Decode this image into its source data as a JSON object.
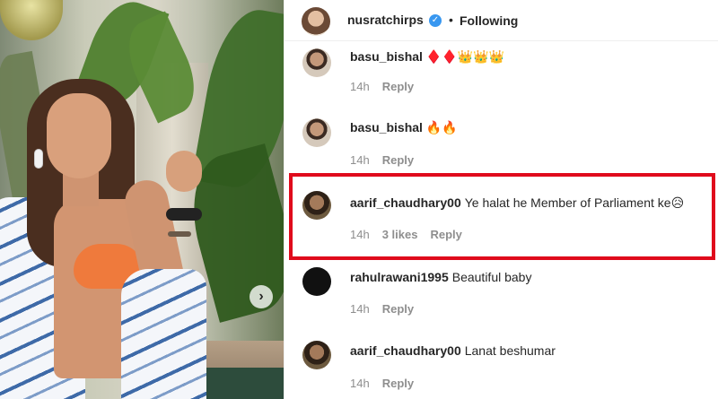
{
  "header": {
    "username": "nusratchirps",
    "verified_icon": "✓",
    "separator": "•",
    "follow_status": "Following"
  },
  "photo": {
    "next_arrow": "›"
  },
  "comments": [
    {
      "username": "basu_bishal",
      "text": "♦️♦️👑👑👑",
      "time": "14h",
      "likes": "",
      "reply": "Reply"
    },
    {
      "username": "basu_bishal",
      "text": "🔥🔥",
      "time": "14h",
      "likes": "",
      "reply": "Reply"
    },
    {
      "username": "aarif_chaudhary00",
      "text": "Ye halat he Member of Parliament ke😥",
      "time": "14h",
      "likes": "3 likes",
      "reply": "Reply"
    },
    {
      "username": "rahulrawani1995",
      "text": "Beautiful baby",
      "time": "14h",
      "likes": "",
      "reply": "Reply"
    },
    {
      "username": "aarif_chaudhary00",
      "text": "Lanat beshumar",
      "time": "14h",
      "likes": "",
      "reply": "Reply"
    }
  ],
  "colors": {
    "highlight_border": "#e00b1c",
    "verified_badge": "#3897f0",
    "meta_gray": "#8e8e8e"
  }
}
